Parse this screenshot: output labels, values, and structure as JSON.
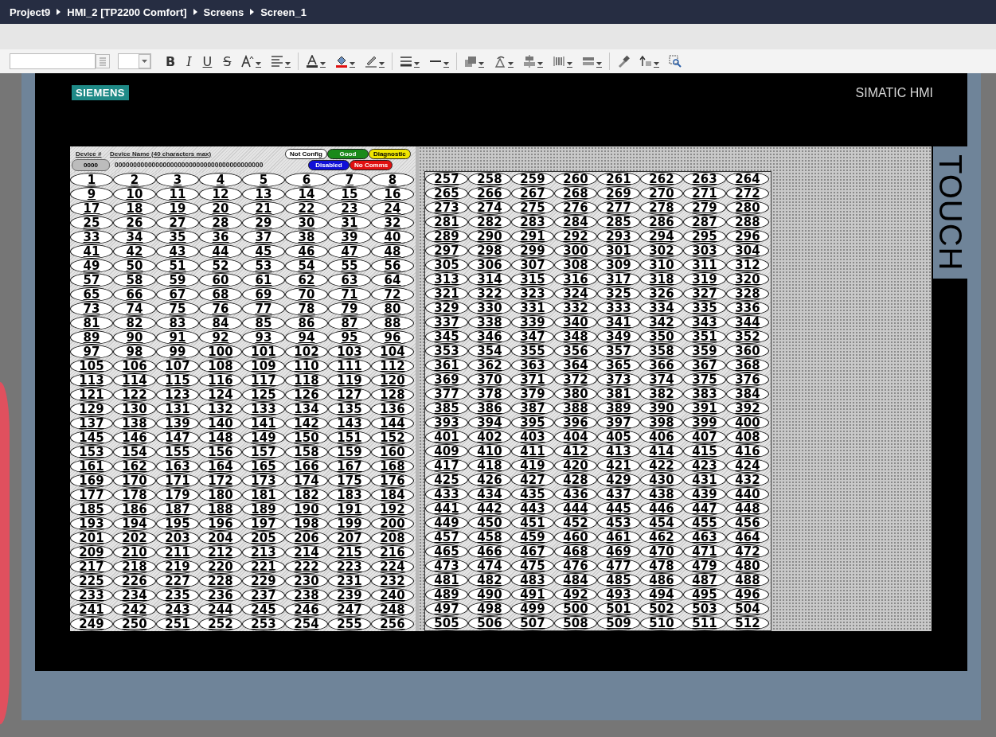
{
  "breadcrumb": [
    "Project9",
    "HMI_2 [TP2200 Comfort]",
    "Screens",
    "Screen_1"
  ],
  "toolbar": [
    {
      "kind": "font-field"
    },
    {
      "kind": "size-field"
    },
    {
      "kind": "bold",
      "label": "B"
    },
    {
      "kind": "italic",
      "label": "I"
    },
    {
      "kind": "underline",
      "label": "U"
    },
    {
      "kind": "strike",
      "label": "S"
    },
    {
      "kind": "grow-font",
      "dropdown": true
    },
    {
      "kind": "text-align",
      "dropdown": true
    },
    {
      "kind": "divider"
    },
    {
      "kind": "font-color",
      "dropdown": true
    },
    {
      "kind": "fill-color",
      "dropdown": true
    },
    {
      "kind": "line-color",
      "dropdown": true
    },
    {
      "kind": "divider"
    },
    {
      "kind": "line-style",
      "dropdown": true
    },
    {
      "kind": "line-weight",
      "dropdown": true
    },
    {
      "kind": "divider"
    },
    {
      "kind": "arrange",
      "dropdown": true
    },
    {
      "kind": "rotate",
      "dropdown": true
    },
    {
      "kind": "align-objects",
      "dropdown": true
    },
    {
      "kind": "distribute",
      "dropdown": true
    },
    {
      "kind": "same-size",
      "dropdown": true
    },
    {
      "kind": "divider"
    },
    {
      "kind": "format-painter",
      "dropdown": false
    },
    {
      "kind": "tab-order",
      "dropdown": true
    },
    {
      "kind": "zoom-select",
      "dropdown": false
    }
  ],
  "hmi": {
    "brand": "SIEMENS",
    "model": "SIMATIC HMI",
    "touch_label": "TOUCH"
  },
  "header": {
    "device_number_label": "Device #",
    "device_name_label": "Device Name (40 characters max)",
    "device_number_value": "0000",
    "device_name_value": "0000000000000000000000000000000000000000",
    "status_legend": [
      [
        {
          "label": "Not Config",
          "color": "#ffffff"
        },
        {
          "label": "Good",
          "color": "#1a8a1a"
        },
        {
          "label": "Diagnostic",
          "color": "#f0e600"
        }
      ],
      [
        {
          "label": "Disabled",
          "color": "#1010d8"
        },
        {
          "label": "No Comms",
          "color": "#e01010"
        }
      ]
    ]
  },
  "left_grid": [
    "1",
    "2",
    "3",
    "4",
    "5",
    "6",
    "7",
    "8",
    "9",
    "10",
    "11",
    "12",
    "13",
    "14",
    "15",
    "16",
    "17",
    "18",
    "19",
    "20",
    "21",
    "22",
    "23",
    "24",
    "25",
    "26",
    "27",
    "28",
    "29",
    "30",
    "31",
    "32",
    "33",
    "34",
    "35",
    "36",
    "37",
    "38",
    "39",
    "40",
    "41",
    "42",
    "43",
    "44",
    "45",
    "46",
    "47",
    "48",
    "49",
    "50",
    "51",
    "52",
    "53",
    "54",
    "55",
    "56",
    "57",
    "58",
    "59",
    "60",
    "61",
    "62",
    "63",
    "64",
    "65",
    "66",
    "67",
    "68",
    "69",
    "70",
    "71",
    "72",
    "73",
    "74",
    "75",
    "76",
    "77",
    "78",
    "79",
    "80",
    "81",
    "82",
    "83",
    "84",
    "85",
    "86",
    "87",
    "88",
    "89",
    "90",
    "91",
    "92",
    "93",
    "94",
    "95",
    "96",
    "97",
    "98",
    "99",
    "100",
    "101",
    "102",
    "103",
    "104",
    "105",
    "106",
    "107",
    "108",
    "109",
    "110",
    "111",
    "112",
    "113",
    "114",
    "115",
    "116",
    "117",
    "118",
    "119",
    "120",
    "121",
    "122",
    "123",
    "124",
    "125",
    "126",
    "127",
    "128",
    "129",
    "130",
    "131",
    "132",
    "133",
    "134",
    "135",
    "136",
    "137",
    "138",
    "139",
    "140",
    "141",
    "142",
    "143",
    "144",
    "145",
    "146",
    "147",
    "148",
    "149",
    "150",
    "151",
    "152",
    "153",
    "154",
    "155",
    "156",
    "157",
    "158",
    "159",
    "160",
    "161",
    "162",
    "163",
    "164",
    "165",
    "166",
    "167",
    "168",
    "169",
    "170",
    "171",
    "172",
    "173",
    "174",
    "175",
    "176",
    "177",
    "178",
    "179",
    "180",
    "181",
    "182",
    "183",
    "184",
    "185",
    "186",
    "187",
    "188",
    "189",
    "190",
    "191",
    "192",
    "193",
    "194",
    "195",
    "196",
    "197",
    "198",
    "199",
    "200",
    "201",
    "202",
    "203",
    "204",
    "205",
    "206",
    "207",
    "208",
    "209",
    "210",
    "211",
    "212",
    "213",
    "214",
    "215",
    "216",
    "217",
    "218",
    "219",
    "220",
    "221",
    "222",
    "223",
    "224",
    "225",
    "226",
    "227",
    "228",
    "229",
    "230",
    "231",
    "232",
    "233",
    "234",
    "235",
    "236",
    "237",
    "238",
    "239",
    "240",
    "241",
    "242",
    "243",
    "244",
    "245",
    "246",
    "247",
    "248",
    "249",
    "250",
    "251",
    "252",
    "253",
    "254",
    "255",
    "256"
  ],
  "right_grid": [
    "257",
    "258",
    "259",
    "260",
    "261",
    "262",
    "263",
    "264",
    "265",
    "266",
    "267",
    "268",
    "269",
    "270",
    "271",
    "272",
    "273",
    "274",
    "275",
    "276",
    "277",
    "278",
    "279",
    "280",
    "281",
    "282",
    "283",
    "284",
    "285",
    "286",
    "287",
    "288",
    "289",
    "290",
    "291",
    "292",
    "293",
    "294",
    "295",
    "296",
    "297",
    "298",
    "299",
    "300",
    "301",
    "302",
    "303",
    "304",
    "305",
    "306",
    "307",
    "308",
    "309",
    "310",
    "311",
    "312",
    "313",
    "314",
    "315",
    "316",
    "317",
    "318",
    "319",
    "320",
    "321",
    "322",
    "323",
    "324",
    "325",
    "326",
    "327",
    "328",
    "329",
    "330",
    "331",
    "332",
    "333",
    "334",
    "335",
    "336",
    "337",
    "338",
    "339",
    "340",
    "341",
    "342",
    "343",
    "344",
    "345",
    "346",
    "347",
    "348",
    "349",
    "350",
    "351",
    "352",
    "353",
    "354",
    "355",
    "356",
    "357",
    "358",
    "359",
    "360",
    "361",
    "362",
    "363",
    "364",
    "365",
    "366",
    "367",
    "368",
    "369",
    "370",
    "371",
    "372",
    "373",
    "374",
    "375",
    "376",
    "377",
    "378",
    "379",
    "380",
    "381",
    "382",
    "383",
    "384",
    "385",
    "386",
    "387",
    "388",
    "389",
    "390",
    "391",
    "392",
    "393",
    "394",
    "395",
    "396",
    "397",
    "398",
    "399",
    "400",
    "401",
    "402",
    "403",
    "404",
    "405",
    "406",
    "407",
    "408",
    "409",
    "410",
    "411",
    "412",
    "413",
    "414",
    "415",
    "416",
    "417",
    "418",
    "419",
    "420",
    "421",
    "422",
    "423",
    "424",
    "425",
    "426",
    "427",
    "428",
    "429",
    "430",
    "431",
    "432",
    "433",
    "434",
    "435",
    "436",
    "437",
    "438",
    "439",
    "440",
    "441",
    "442",
    "443",
    "444",
    "445",
    "446",
    "447",
    "448",
    "449",
    "450",
    "451",
    "452",
    "453",
    "454",
    "455",
    "456",
    "457",
    "458",
    "459",
    "460",
    "461",
    "462",
    "463",
    "464",
    "465",
    "466",
    "467",
    "468",
    "469",
    "470",
    "471",
    "472",
    "473",
    "474",
    "475",
    "476",
    "477",
    "478",
    "479",
    "480",
    "481",
    "482",
    "483",
    "484",
    "485",
    "486",
    "487",
    "488",
    "489",
    "490",
    "491",
    "492",
    "493",
    "494",
    "495",
    "496",
    "497",
    "498",
    "499",
    "500",
    "501",
    "502",
    "503",
    "504",
    "505",
    "506",
    "507",
    "508",
    "509",
    "510",
    "511",
    "512"
  ]
}
